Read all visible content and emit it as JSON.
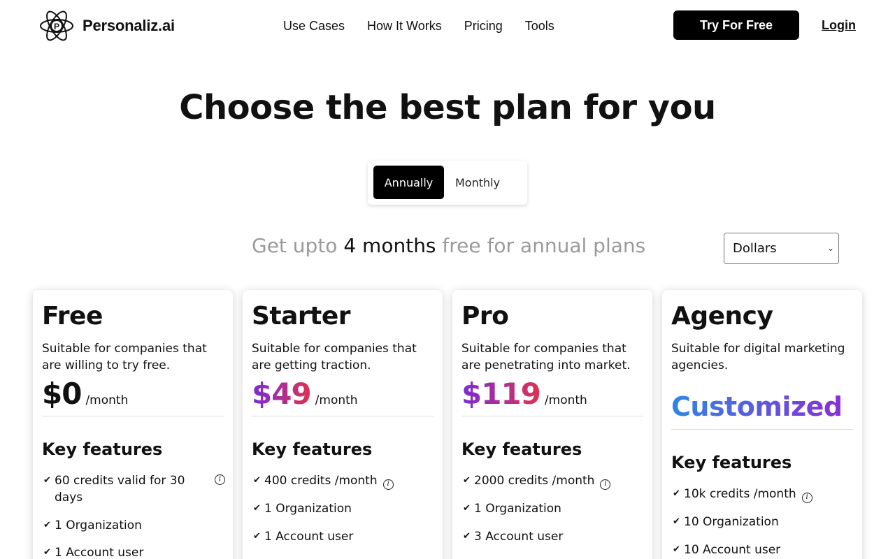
{
  "header": {
    "logo_text": "Personaliz.ai",
    "logo_letter": "P",
    "nav": [
      "Use Cases",
      "How It Works",
      "Pricing",
      "Tools"
    ],
    "cta": "Try For Free",
    "login": "Login"
  },
  "title": "Choose the best plan for you",
  "billing_toggle": {
    "active": "Annually",
    "other": "Monthly"
  },
  "promo": {
    "pre": "Get upto ",
    "highlight": "4 months",
    "post": " free for annual plans"
  },
  "currency": {
    "selected": "Dollars"
  },
  "plans": [
    {
      "name": "Free",
      "desc": "Suitable for companies that are willing to try free.",
      "price": "$0",
      "per": "/month",
      "key_features": "Key features",
      "features": [
        "60 credits valid for 30 days",
        "1 Organization",
        "1 Account user"
      ]
    },
    {
      "name": "Starter",
      "desc": "Suitable for companies that are getting traction.",
      "price": "$49",
      "per": "/month",
      "key_features": "Key features",
      "features": [
        "400 credits /month",
        "1 Organization",
        "1 Account user"
      ]
    },
    {
      "name": "Pro",
      "desc": "Suitable for companies that are penetrating into market.",
      "price": "$119",
      "per": "/month",
      "key_features": "Key features",
      "features": [
        "2000 credits /month",
        "1 Organization",
        "3 Account user"
      ]
    },
    {
      "name": "Agency",
      "desc": "Suitable for digital marketing agencies.",
      "price": "Customized",
      "key_features": "Key features",
      "features": [
        "10k credits /month",
        "10 Organization",
        "10 Account user"
      ]
    }
  ],
  "colors": {
    "gradient_price": [
      "#7a2bd6",
      "#e0314f"
    ],
    "gradient_custom": [
      "#2f86e6",
      "#8a2fd4"
    ],
    "accent": "#000000"
  },
  "icons": {
    "check": "check-icon",
    "info": "info-icon",
    "chevron": "chevron-down-icon",
    "logo": "atom-logo-icon"
  }
}
